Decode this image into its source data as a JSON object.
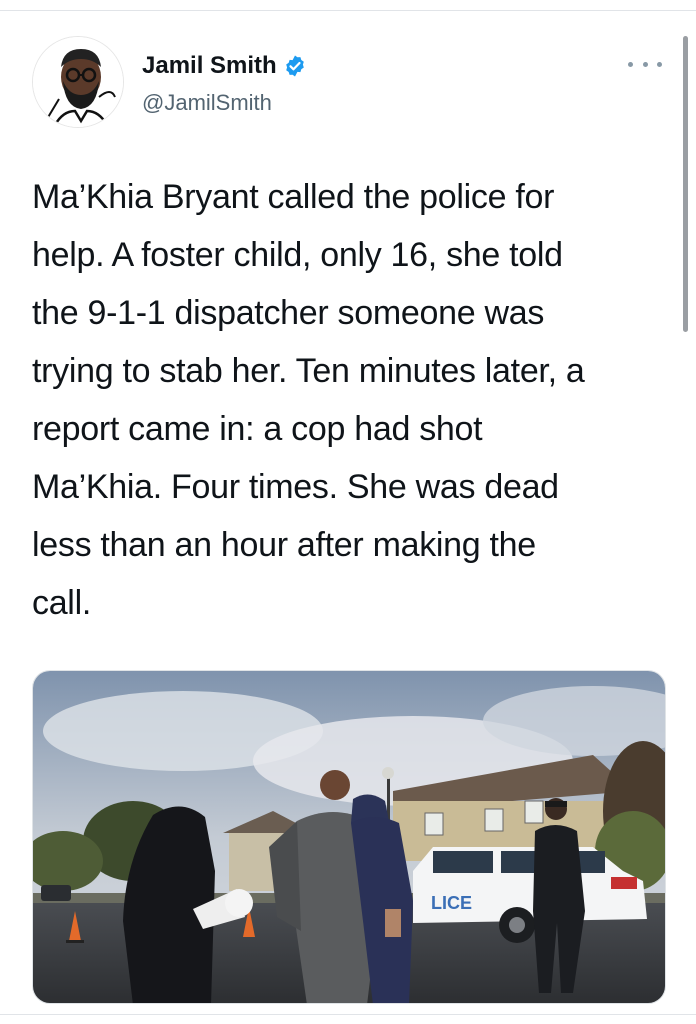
{
  "tweet": {
    "author": {
      "display_name": "Jamil Smith",
      "handle": "@JamilSmith",
      "verified": true,
      "avatar_icon": "avatar-illustration"
    },
    "more_icon": "more-horizontal-icon",
    "text_lines": [
      "Ma’Khia Bryant called the police for",
      "help. A foster child, only 16, she told",
      "the 9-1-1 dispatcher someone was",
      "trying to stab her. Ten minutes later, a",
      "report came in: a cop had shot",
      "Ma’Khia. Four times. She was dead",
      "less than an hour after making the",
      "call."
    ],
    "media": {
      "type": "photo",
      "vehicle_lettering": "LICE"
    }
  },
  "colors": {
    "text": "#0f1419",
    "secondary_text": "#536471",
    "verified_blue": "#1d9bf0",
    "divider": "#e1e4e8"
  }
}
